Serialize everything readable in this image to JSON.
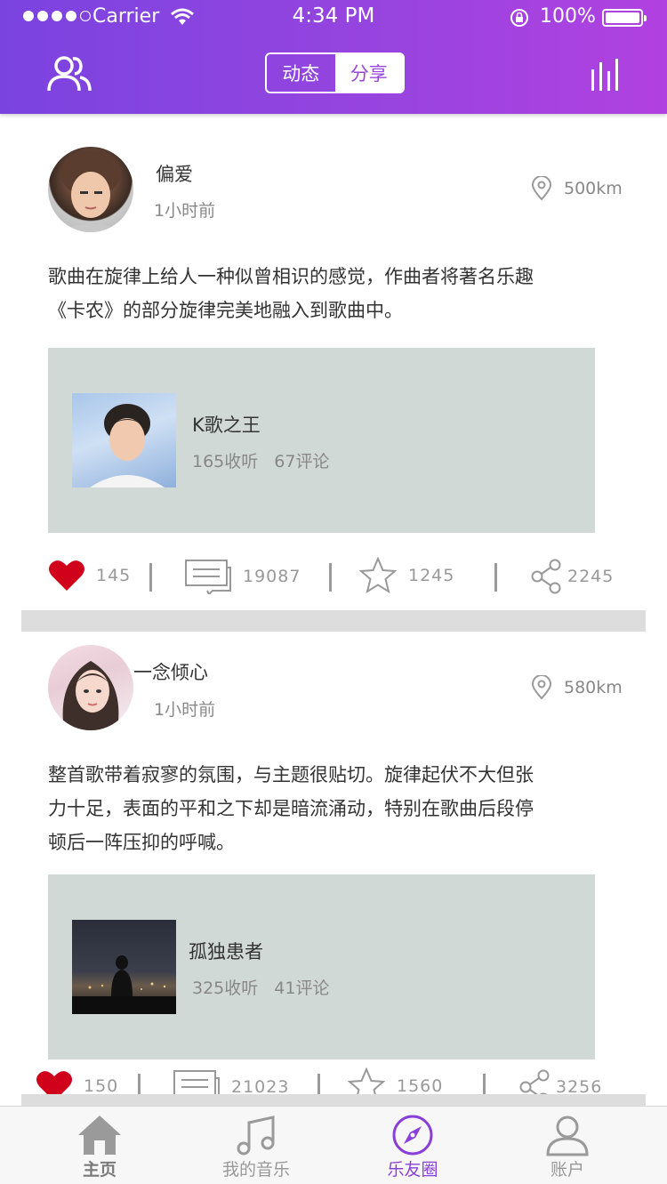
{
  "status_bar": {
    "carrier": "Carrier",
    "time": "4:34 PM",
    "battery": "100%"
  },
  "header": {
    "tabs": [
      "动态",
      "分享"
    ],
    "active_tab": "动态",
    "left_icon": "friends-icon",
    "right_icon": "equalizer-icon"
  },
  "colors": {
    "accent": "#9b46df",
    "heart": "#d0021b",
    "card_bg": "#d1d9d7"
  },
  "posts": [
    {
      "username": "偏爱",
      "time": "1小时前",
      "distance": "500km",
      "text_lines": [
        "歌曲在旋律上给人一种似曾相识的感觉，作曲者将著名乐趣",
        "《卡农》的部分旋律完美地融入到歌曲中。"
      ],
      "song": {
        "title": "K歌之王",
        "plays": "165收听",
        "comments": "67评论"
      },
      "likes": "145",
      "comments": "19087",
      "favorites": "1245",
      "shares": "2245"
    },
    {
      "username": "一念倾心",
      "time": "1小时前",
      "distance": "580km",
      "text_lines": [
        "整首歌带着寂寥的氛围，与主题很贴切。旋律起伏不大但张",
        "力十足，表面的平和之下却是暗流涌动，特别在歌曲后段停",
        "顿后一阵压抑的呼喊。"
      ],
      "song": {
        "title": "孤独患者",
        "plays": "325收听",
        "comments": "41评论"
      },
      "likes": "150",
      "comments": "21023",
      "favorites": "1560",
      "shares": "3256"
    }
  ],
  "tabbar": [
    {
      "label": "主页",
      "icon": "home-icon"
    },
    {
      "label": "我的音乐",
      "icon": "music-note-icon"
    },
    {
      "label": "乐友圈",
      "icon": "compass-icon",
      "active": true
    },
    {
      "label": "账户",
      "icon": "user-icon"
    }
  ]
}
